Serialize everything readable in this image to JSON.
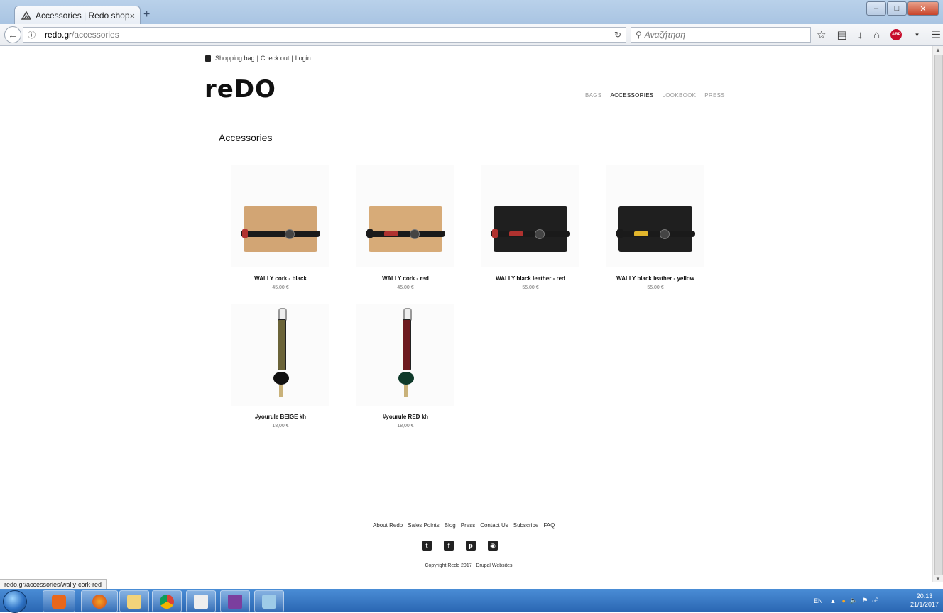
{
  "browser": {
    "tab_title": "Accessories | Redo shop",
    "tab_close": "×",
    "new_tab": "+",
    "url_host": "redo.gr",
    "url_path": "/accessories",
    "search_placeholder": "Αναζήτηση",
    "status_url": "redo.gr/accessories/wally-cork-red"
  },
  "site": {
    "shopping_bag": "Shopping bag",
    "checkout": "Check out",
    "login": "Login",
    "logo": "reDO",
    "nav": [
      "BAGS",
      "ACCESSORIES",
      "LOOKBOOK",
      "PRESS"
    ],
    "nav_active": "ACCESSORIES",
    "page_title": "Accessories"
  },
  "products": [
    {
      "name": "WALLY cork - black",
      "price": "45,00 €",
      "type": "wallet",
      "body_color": "#d2a574",
      "strap_tag": "#1a1a1a",
      "end_color": "#b0322f"
    },
    {
      "name": "WALLY cork - red",
      "price": "45,00 €",
      "type": "wallet",
      "body_color": "#d7ab78",
      "strap_tag": "#b0322f",
      "end_color": "#1a1a1a"
    },
    {
      "name": "WALLY black leather - red",
      "price": "55,00 €",
      "type": "wallet",
      "body_color": "#1f1f1f",
      "strap_tag": "#b0322f",
      "end_color": "#b0322f"
    },
    {
      "name": "WALLY black leather - yellow",
      "price": "55,00 €",
      "type": "wallet",
      "body_color": "#1f1f1f",
      "strap_tag": "#e1b52c",
      "end_color": "#1a1a1a"
    },
    {
      "name": "#yourule BEIGE kh",
      "price": "18,00 €",
      "type": "keyholder",
      "band_color": "#6b6439"
    },
    {
      "name": "#yourule RED kh",
      "price": "18,00 €",
      "type": "keyholder",
      "band_color": "#6e1a1f"
    }
  ],
  "footer": {
    "links": [
      "About Redo",
      "Sales Points",
      "Blog",
      "Press",
      "Contact Us",
      "Subscribe",
      "FAQ"
    ],
    "social": [
      "twitter-icon",
      "facebook-icon",
      "pinterest-icon",
      "instagram-icon"
    ],
    "copyright": "Copyright Redo 2017 | Drupal Websites"
  },
  "taskbar": {
    "lang": "EN",
    "time": "20:13",
    "date": "21/1/2017"
  },
  "colors": {
    "accent": "#111111",
    "muted": "#999999"
  }
}
